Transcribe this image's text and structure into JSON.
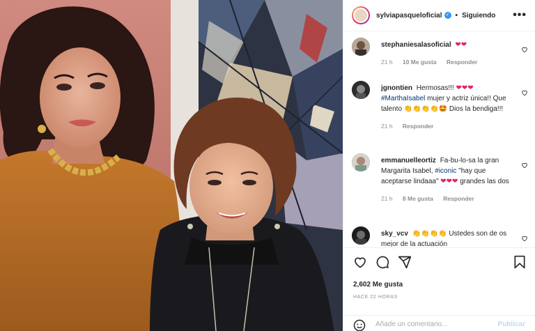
{
  "post": {
    "username": "sylviapasqueloficial",
    "separator": "•",
    "follow_status": "Siguiendo",
    "more_label": "•••"
  },
  "comments": [
    {
      "user": "stephaniesalasoficial",
      "text": "",
      "emoji": "❤❤",
      "time": "21 h",
      "likes": "10 Me gusta",
      "reply": "Responder"
    },
    {
      "user": "jgnontien",
      "text_1": "Hermosas!!!",
      "emoji_1": "❤❤❤",
      "tag": "#MarthaIsabel",
      "text_2": "mujer y actriz única!! Que talento",
      "emoji_2": "👏👏👏👏🤩",
      "text_3": "Dios la bendiga!!!",
      "time": "21 h",
      "reply": "Responder"
    },
    {
      "user": "emmanuelleortiz",
      "text_1": "Fa-bu-lo-sa la gran Margarita Isabel,",
      "tag": "#iconic",
      "text_2": "\"hay que aceptarse lindaaa\"",
      "emoji": "❤❤❤",
      "text_3": "grandes las dos",
      "time": "21 h",
      "likes": "8 Me gusta",
      "reply": "Responder"
    },
    {
      "user": "sky_vcv",
      "emoji": "👏👏👏👏",
      "text": "Ustedes son de os mejor de la actuación"
    }
  ],
  "stats": {
    "likes": "2,602 Me gusta",
    "ago": "HACE 22 HORAS"
  },
  "composer": {
    "placeholder": "Añade un comentario...",
    "publish": "Publicar"
  },
  "icons": [
    "heart-icon",
    "comment-icon",
    "share-icon",
    "bookmark-icon",
    "smile-icon",
    "verified-icon",
    "more-icon"
  ],
  "colors": {
    "verified": "#3897f0",
    "link": "#00376b",
    "muted": "#8e8e8e",
    "publish_disabled": "#b2dffc",
    "heart": "#e0245e"
  }
}
